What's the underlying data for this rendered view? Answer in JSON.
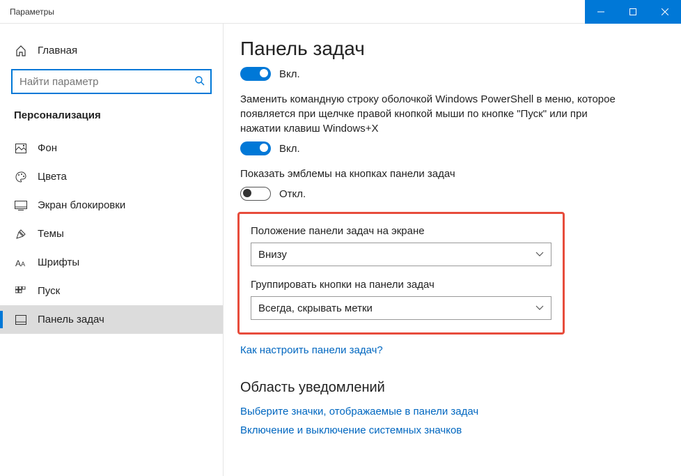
{
  "window": {
    "title": "Параметры"
  },
  "sidebar": {
    "home": "Главная",
    "search_placeholder": "Найти параметр",
    "section": "Персонализация",
    "items": [
      {
        "label": "Фон"
      },
      {
        "label": "Цвета"
      },
      {
        "label": "Экран блокировки"
      },
      {
        "label": "Темы"
      },
      {
        "label": "Шрифты"
      },
      {
        "label": "Пуск"
      },
      {
        "label": "Панель задач"
      }
    ]
  },
  "main": {
    "title": "Панель задач",
    "toggle1": {
      "state": "Вкл."
    },
    "desc1": "Заменить командную строку оболочкой Windows PowerShell в меню, которое появляется при щелчке правой кнопкой мыши по кнопке \"Пуск\" или при нажатии клавиш Windows+X",
    "toggle2": {
      "state": "Вкл."
    },
    "desc2": "Показать эмблемы на кнопках панели задач",
    "toggle3": {
      "state": "Откл."
    },
    "position_label": "Положение панели задач на экране",
    "position_value": "Внизу",
    "group_label": "Группировать кнопки на панели задач",
    "group_value": "Всегда, скрывать метки",
    "help_link": "Как настроить панели задач?",
    "section2": "Область уведомлений",
    "link2": "Выберите значки, отображаемые в панели задач",
    "link3": "Включение и выключение системных значков"
  }
}
